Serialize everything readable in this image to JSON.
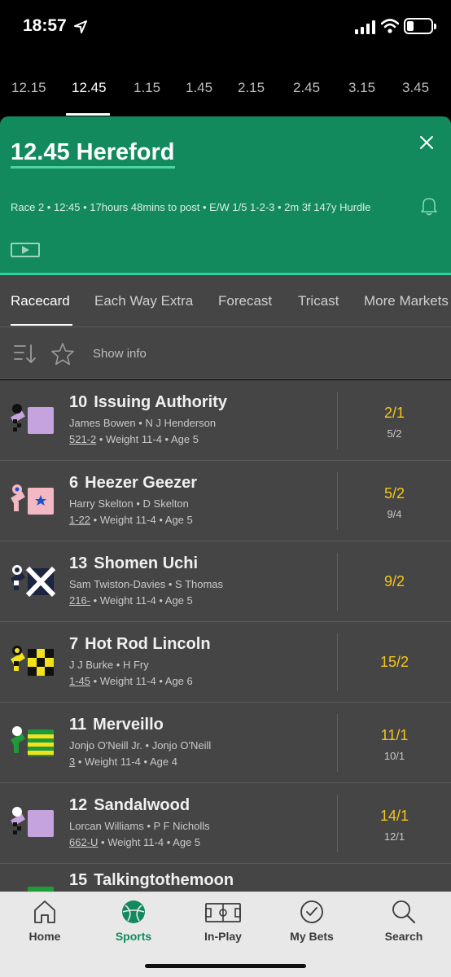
{
  "status": {
    "time": "18:57"
  },
  "race_times": [
    "12.15",
    "12.45",
    "1.15",
    "1.45",
    "2.15",
    "2.45",
    "3.15",
    "3.45"
  ],
  "race": {
    "title": "12.45 Hereford",
    "info": "Race 2 • 12:45 • 17hours 48mins to post • E/W 1/5 1-2-3 • 2m 3f 147y Hurdle"
  },
  "market_tabs": [
    "Racecard",
    "Each Way Extra",
    "Forecast",
    "Tricast",
    "More Markets"
  ],
  "toolbar": {
    "show_info": "Show info"
  },
  "runners": [
    {
      "number": "10",
      "name": "Issuing Authority",
      "jockey": "James Bowen",
      "trainer": "N J Henderson",
      "form": "521-2",
      "weight": "Weight 11-4",
      "age": "Age 5",
      "odds": "2/1",
      "prev_odds": "5/2",
      "silk": "lilac"
    },
    {
      "number": "6",
      "name": "Heezer Geezer",
      "jockey": "Harry Skelton",
      "trainer": "D Skelton",
      "form": "1-22",
      "weight": "Weight 11-4",
      "age": "Age 5",
      "odds": "5/2",
      "prev_odds": "9/4",
      "silk": "pink-star"
    },
    {
      "number": "13",
      "name": "Shomen Uchi",
      "jockey": "Sam Twiston-Davies",
      "trainer": "S Thomas",
      "form": "216-",
      "weight": "Weight 11-4",
      "age": "Age 5",
      "odds": "9/2",
      "prev_odds": "",
      "silk": "navy-cross"
    },
    {
      "number": "7",
      "name": "Hot Rod Lincoln",
      "jockey": "J J Burke",
      "trainer": "H Fry",
      "form": "1-45",
      "weight": "Weight 11-4",
      "age": "Age 6",
      "odds": "15/2",
      "prev_odds": "",
      "silk": "yellow-black-check"
    },
    {
      "number": "11",
      "name": "Merveillo",
      "jockey": "Jonjo O'Neill Jr.",
      "trainer": "Jonjo O'Neill",
      "form": "3",
      "weight": "Weight 11-4",
      "age": "Age 4",
      "odds": "11/1",
      "prev_odds": "10/1",
      "silk": "green-yellow-hoops"
    },
    {
      "number": "12",
      "name": "Sandalwood",
      "jockey": "Lorcan Williams",
      "trainer": "P F Nicholls",
      "form": "662-U",
      "weight": "Weight 11-4",
      "age": "Age 5",
      "odds": "14/1",
      "prev_odds": "12/1",
      "silk": "lilac"
    },
    {
      "number": "15",
      "name": "Talkingtothemoon",
      "jockey": "",
      "trainer": "",
      "form": "",
      "weight": "",
      "age": "",
      "odds": "",
      "prev_odds": "",
      "silk": "green"
    }
  ],
  "bottom_nav": [
    {
      "label": "Home",
      "icon": "home-icon"
    },
    {
      "label": "Sports",
      "icon": "sports-ball-icon",
      "active": true
    },
    {
      "label": "In-Play",
      "icon": "pitch-icon"
    },
    {
      "label": "My Bets",
      "icon": "check-circle-icon"
    },
    {
      "label": "Search",
      "icon": "search-icon"
    }
  ],
  "colors": {
    "brand_green": "#138a5e",
    "odds_yellow": "#f5c518",
    "panel": "#454545"
  }
}
